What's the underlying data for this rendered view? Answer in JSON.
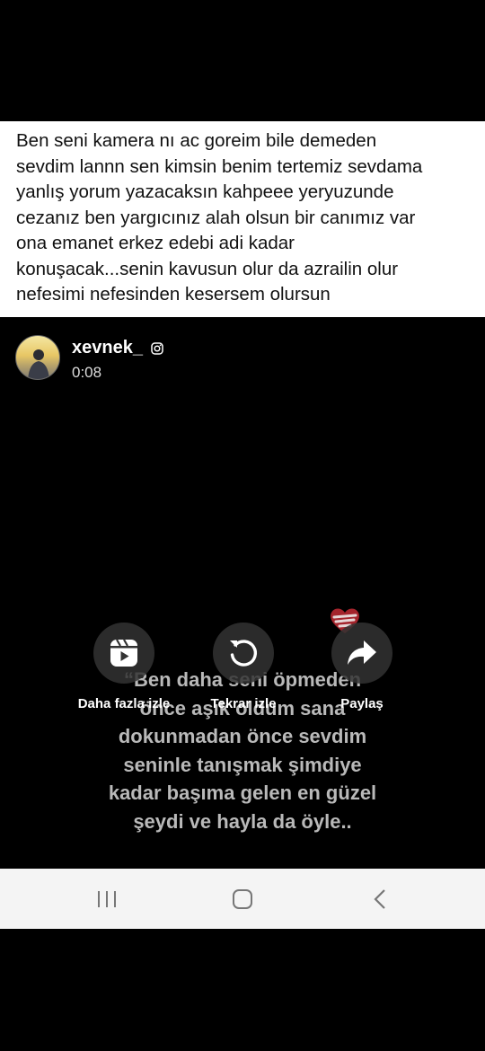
{
  "post": {
    "caption": "Ben seni kamera nı ac goreim bile demeden\nsevdim lannn sen kimsin benim tertemiz sevdama\nyanlış yorum yazacaksın kahpeee yeryuzunde\ncezanız ben yargıcınız alah olsun bir canımız var\nona emanet erkez edebi adi kadar\nkonuşacak...senin kavusun olur da azrailin olur\nnefesimi nefesinden kesersem olursun"
  },
  "video": {
    "username": "xevnek_",
    "duration": "0:08",
    "overlay_text": "“Ben daha seni öpmeden\nönce aşık oldum sana\ndokunmadan önce sevdim\nseninle tanışmak şimdiye\nkadar başıma gelen en güzel\nşeydi ve hayla da öyle..",
    "controls": {
      "more": "Daha fazla izle",
      "replay": "Tekrar izle",
      "share": "Paylaş"
    }
  },
  "icons": {
    "platform": "instagram-icon",
    "more": "reels-icon",
    "replay": "replay-icon",
    "share": "share-arrow-icon",
    "nav": [
      "recent-apps-icon",
      "home-icon",
      "back-icon"
    ]
  }
}
